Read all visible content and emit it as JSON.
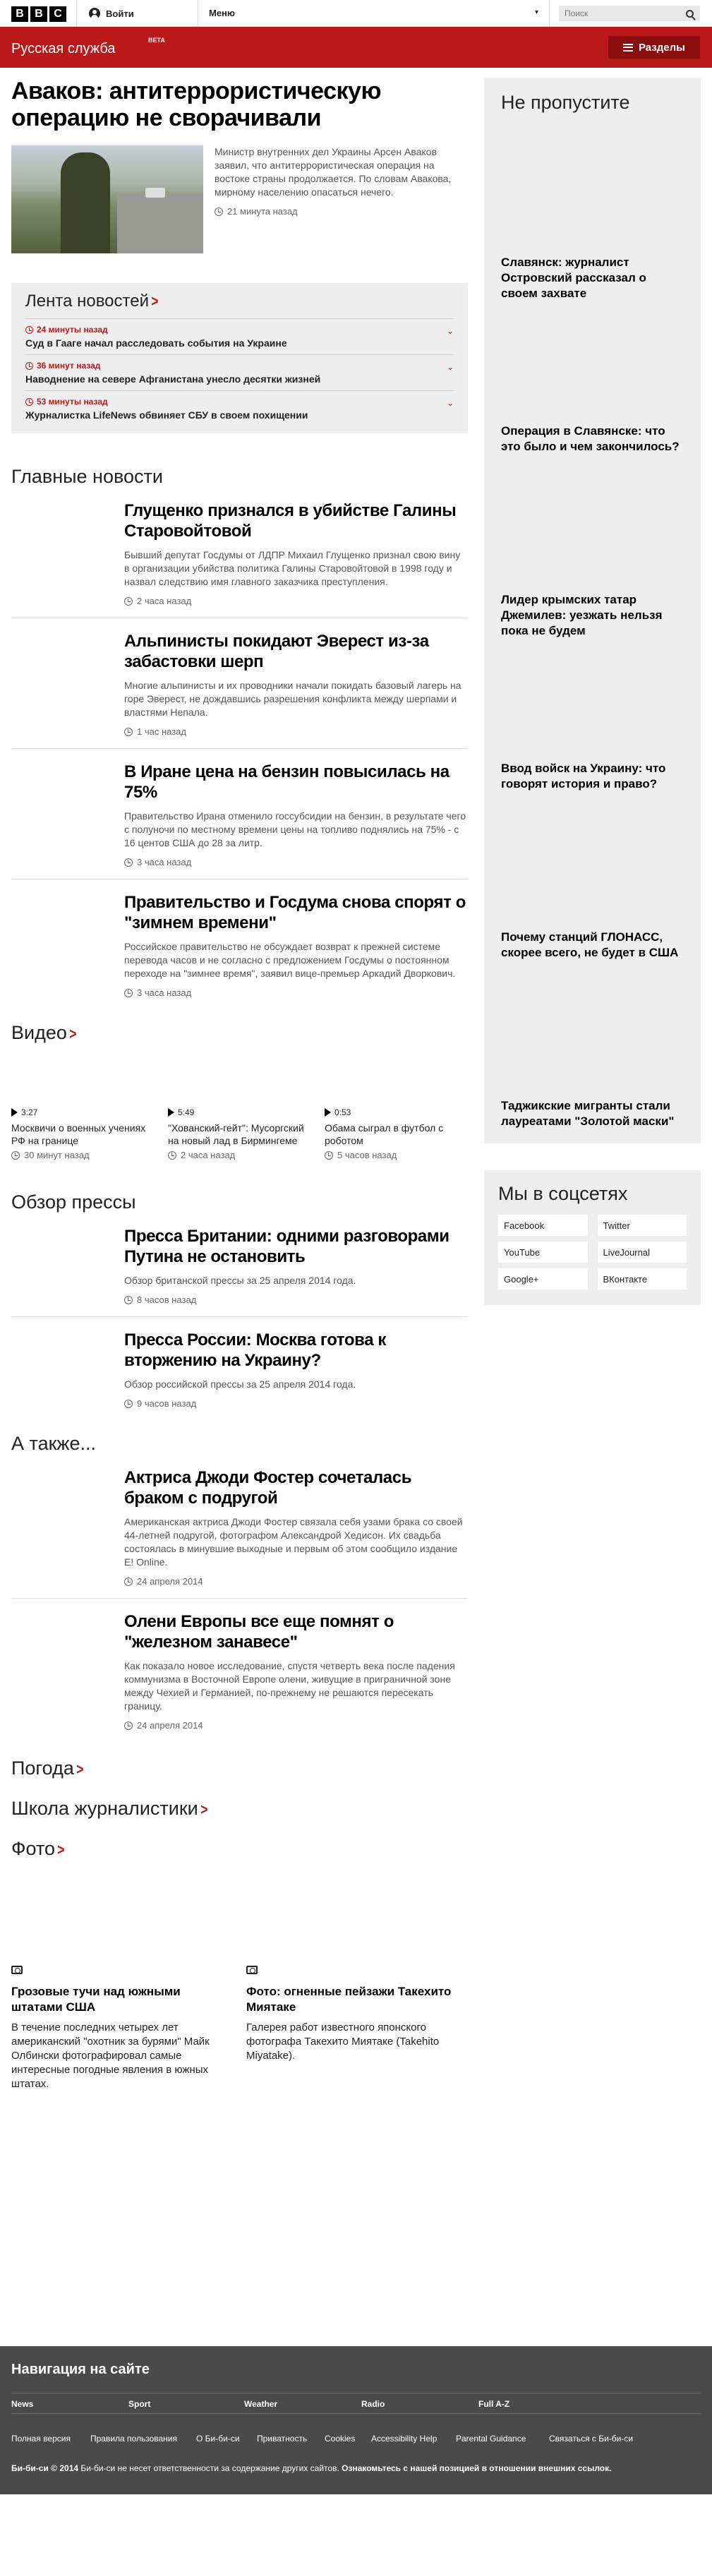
{
  "topbar": {
    "logo_letters": [
      "B",
      "B",
      "C"
    ],
    "signin_label": "Войти",
    "menu_label": "Меню",
    "menu_caret": "▾",
    "search_placeholder": "Поиск"
  },
  "header": {
    "service_name": "Русская служба",
    "beta_label": "BETA",
    "sections_label": "Разделы"
  },
  "lead": {
    "title": "Аваков: антитеррористическую операцию не сворачивали",
    "summary": "Министр внутренних дел Украины Арсен Аваков заявил, что антитеррористическая операция на востоке страны продолжается. По словам Авакова, мирному населению опасаться нечего.",
    "time": "21 минута назад"
  },
  "feed": {
    "title": "Лента новостей",
    "items": [
      {
        "time": "24 минуты назад",
        "headline": "Суд в Гааге начал расследовать события на Украине"
      },
      {
        "time": "36 минут назад",
        "headline": "Наводнение на севере Афганистана унесло десятки жизней"
      },
      {
        "time": "53 минуты назад",
        "headline": "Журналистка LifeNews обвиняет СБУ в своем похищении"
      }
    ]
  },
  "top_stories": {
    "title": "Главные новости",
    "items": [
      {
        "title": "Глущенко признался в убийстве Галины Старовойтовой",
        "summary": "Бывший депутат Госдумы от ЛДПР Михаил Глущенко признал свою вину в организации убийства политика Галины Старовойтовой в 1998 году и назвал следствию имя главного заказчика преступления.",
        "time": "2 часа назад"
      },
      {
        "title": "Альпинисты покидают Эверест из-за забастовки шерп",
        "summary": "Многие альпинисты и их проводники начали покидать базовый лагерь на горе Эверест, не дождавшись разрешения конфликта между шерпами и властями Непала.",
        "time": "1 час назад"
      },
      {
        "title": "В Иране цена на бензин повысилась на 75%",
        "summary": "Правительство Ирана отменило госсубсидии на бензин, в результате чего с полуночи по местному времени цены на топливо поднялись на 75% - с 16 центов США до 28 за литр.",
        "time": "3 часа назад"
      },
      {
        "title": "Правительство и Госдума снова спорят о \"зимнем времени\"",
        "summary": "Российское правительство не обсуждает возврат к прежней системе перевода часов и не согласно с предложением Госдумы о постоянном переходе на \"зимнее время\", заявил вице-премьер Аркадий Дворкович.",
        "time": "3 часа назад"
      }
    ]
  },
  "sidebar": {
    "title": "Не пропустите",
    "items": [
      "Славянск: журналист Островский рассказал о своем захвате",
      "Операция в Славянске: что это было и чем закончилось?",
      "Лидер крымских татар Джемилев: уезжать нельзя пока не будем",
      "Ввод войск на Украину: что говорят история и право?",
      "Почему станций ГЛОНАСС, скорее всего, не будет в США",
      "Таджикские мигранты стали лауреатами \"Золотой маски\""
    ]
  },
  "video": {
    "title": "Видео",
    "items": [
      {
        "duration": "3:27",
        "title": "Москвичи о военных учениях РФ на границе",
        "time": "30 минут назад"
      },
      {
        "duration": "5:49",
        "title": "\"Хованский-гейт\": Мусоргский на новый лад в Бирмингеме",
        "time": "2 часа назад"
      },
      {
        "duration": "0:53",
        "title": "Обама сыграл в футбол с роботом",
        "time": "5 часов назад"
      }
    ]
  },
  "social": {
    "title": "Мы в соцсетях",
    "items": [
      "Facebook",
      "Twitter",
      "YouTube",
      "LiveJournal",
      "Google+",
      "ВКонтакте"
    ]
  },
  "press": {
    "title": "Обзор прессы",
    "items": [
      {
        "title": "Пресса Британии: одними разговорами Путина не остановить",
        "summary": "Обзор британской прессы за 25 апреля 2014 года.",
        "time": "8 часов назад"
      },
      {
        "title": "Пресса России: Москва готова к вторжению на Украину?",
        "summary": "Обзор российской прессы за 25 апреля 2014 года.",
        "time": "9 часов назад"
      }
    ]
  },
  "also": {
    "title": "А также...",
    "items": [
      {
        "title": "Актриса Джоди Фостер сочеталась браком с подругой",
        "summary": "Американская актриса Джоди Фостер связала себя узами брака со своей 44-летней подругой, фотографом Александрой Хедисон. Их свадьба состоялась в минувшие выходные и первым об этом сообщило издание E! Online.",
        "time": "24 апреля 2014"
      },
      {
        "title": "Олени Европы все еще помнят о \"железном занавесе\"",
        "summary": "Как показало новое исследование, спустя четверть века после падения коммунизма в Восточной Европе олени, живущие в приграничной зоне между Чехией и Германией, по-прежнему не решаются пересекать границу.",
        "time": "24 апреля 2014"
      }
    ]
  },
  "weather": {
    "title": "Погода"
  },
  "school": {
    "title": "Школа журналистики"
  },
  "photo": {
    "title": "Фото",
    "items": [
      {
        "title": "Грозовые тучи над южными штатами США",
        "summary": "В течение последних четырех лет американский \"охотник за бурями\" Майк Олбински фотографировал самые интересные погодные явления в южных штатах."
      },
      {
        "title": "Фото: огненные пейзажи Такехито Миятаке",
        "summary": "Галерея работ известного японского фотографа Такехито Миятаке (Takehito Miyatake)."
      }
    ]
  },
  "footer": {
    "title": "Навигация на сайте",
    "nav": [
      "News",
      "Sport",
      "Weather",
      "Radio",
      "Full A-Z"
    ],
    "links": [
      "Полная версия",
      "Правила пользования",
      "О Би-би-си",
      "Приватность",
      "Cookies",
      "Accessibility Help",
      "Parental Guidance",
      "Связаться с Би-би-си"
    ],
    "copyright": "Би-би-си © 2014",
    "disclaimer": "Би-би-си не несет ответственности за содержание других сайтов.",
    "external_link": "Ознакомьтесь с нашей позицией в отношении внешних ссылок."
  }
}
